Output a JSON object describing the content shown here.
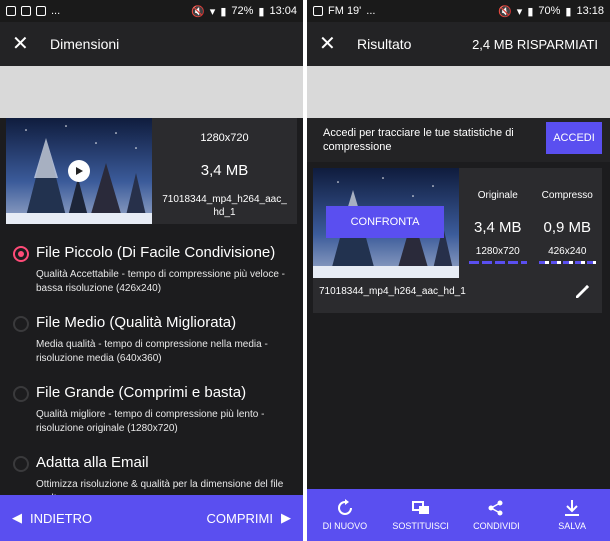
{
  "left": {
    "status": {
      "right_text": "72%",
      "time": "13:04",
      "left_extra": "..."
    },
    "toolbar": {
      "title": "Dimensioni"
    },
    "media": {
      "resolution": "1280x720",
      "size": "3,4 MB",
      "filename": "71018344_mp4_h264_aac_hd_1"
    },
    "options": [
      {
        "title": "File Piccolo (Di Facile Condivisione)",
        "desc": "Qualità Accettabile - tempo di compressione più veloce - bassa risoluzione (426x240)",
        "selected": true
      },
      {
        "title": "File Medio (Qualità Migliorata)",
        "desc": "Media qualità - tempo di compressione nella media - risoluzione media (640x360)",
        "selected": false
      },
      {
        "title": "File Grande (Comprimi e basta)",
        "desc": "Qualità migliore - tempo di compressione più lento - risoluzione originale (1280x720)",
        "selected": false
      },
      {
        "title": "Adatta alla Email",
        "desc": "Ottimizza risoluzione & qualità per la dimensione del file scelta",
        "selected": false
      }
    ],
    "bottom": {
      "back": "INDIETRO",
      "next": "COMPRIMI"
    }
  },
  "right": {
    "status": {
      "left_text": "FM 19'",
      "right_text": "70%",
      "time": "13:18",
      "left_extra": "..."
    },
    "toolbar": {
      "title": "Risultato",
      "saved": "2,4 MB RISPARMIATI"
    },
    "login": {
      "text": "Accedi per tracciare le tue statistiche di compressione",
      "button": "ACCEDI"
    },
    "result": {
      "compare_button": "CONFRONTA",
      "original": {
        "label": "Originale",
        "size": "3,4 MB",
        "resolution": "1280x720"
      },
      "compressed": {
        "label": "Compresso",
        "size": "0,9 MB",
        "resolution": "426x240"
      },
      "filename": "71018344_mp4_h264_aac_hd_1"
    },
    "actions": [
      "DI NUOVO",
      "SOSTITUISCI",
      "CONDIVIDI",
      "SALVA"
    ]
  },
  "colors": {
    "accent": "#5a4ff0",
    "radio_selected": "#ff4b78",
    "background": "#1c1c1e",
    "banner": "#d9d9d9"
  }
}
